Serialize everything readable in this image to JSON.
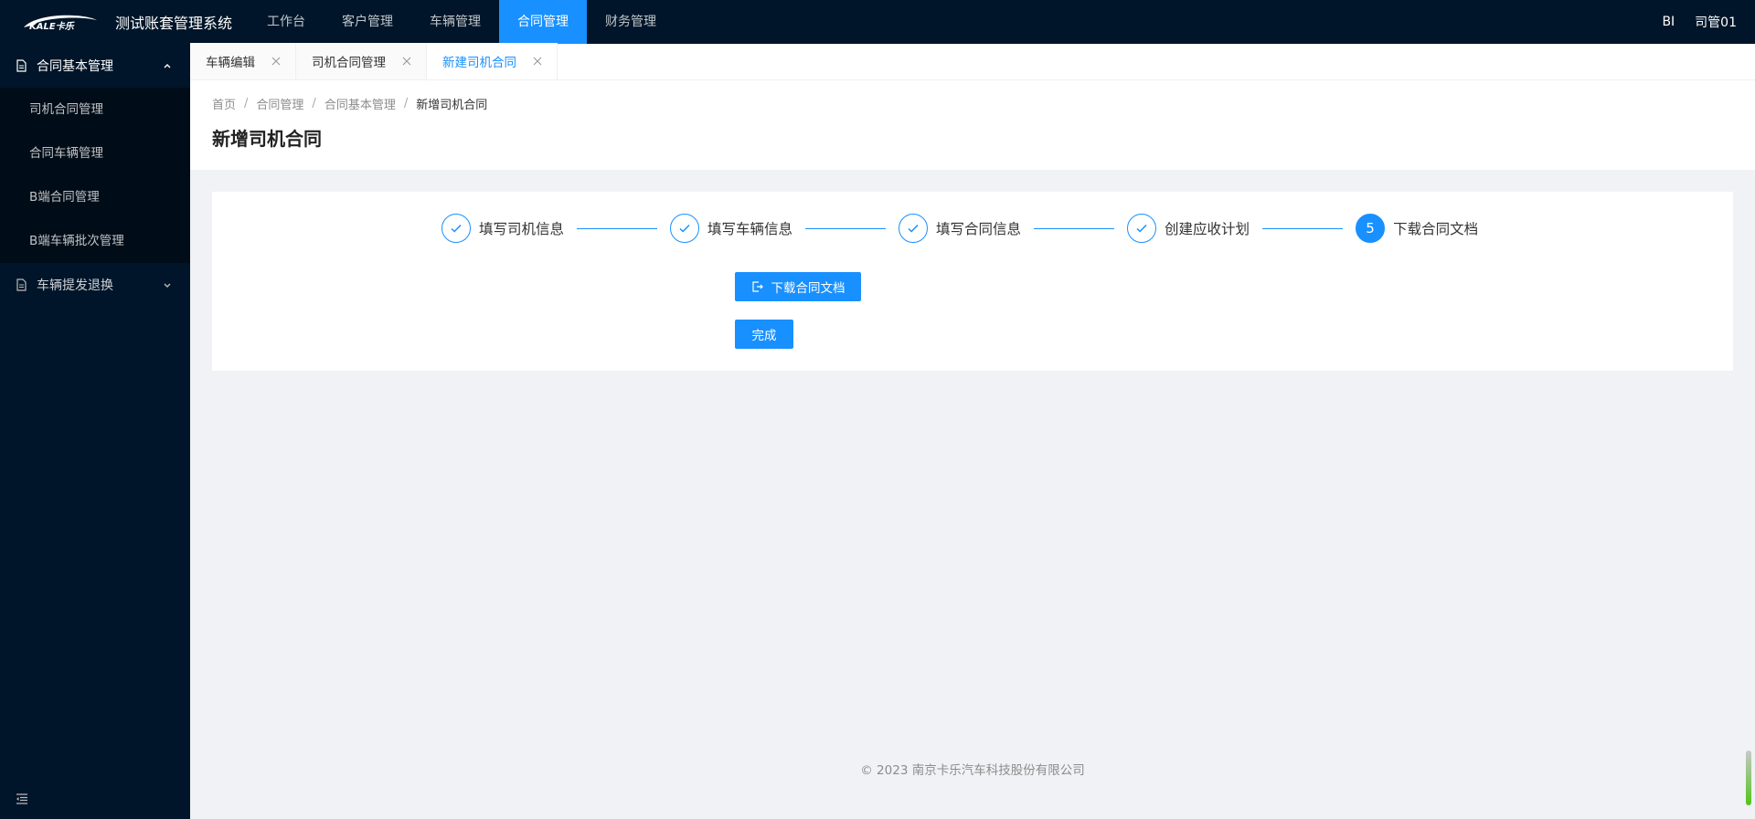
{
  "header": {
    "logo_text": "KALE卡乐",
    "title": "测试账套管理系统",
    "nav": [
      {
        "label": "工作台"
      },
      {
        "label": "客户管理"
      },
      {
        "label": "车辆管理"
      },
      {
        "label": "合同管理"
      },
      {
        "label": "财务管理"
      }
    ],
    "active_nav": "合同管理",
    "bi_label": "BI",
    "user_name": "司管01"
  },
  "sidebar": {
    "groups": [
      {
        "label": "合同基本管理",
        "expanded": true,
        "items": [
          {
            "label": "司机合同管理"
          },
          {
            "label": "合同车辆管理"
          },
          {
            "label": "B端合同管理"
          },
          {
            "label": "B端车辆批次管理"
          }
        ]
      },
      {
        "label": "车辆提发退换",
        "expanded": false
      }
    ]
  },
  "tabs": [
    {
      "label": "车辆编辑"
    },
    {
      "label": "司机合同管理"
    },
    {
      "label": "新建司机合同"
    }
  ],
  "active_tab": "新建司机合同",
  "breadcrumb": [
    "首页",
    "合同管理",
    "合同基本管理",
    "新增司机合同"
  ],
  "page_title": "新增司机合同",
  "steps": [
    {
      "title": "填写司机信息",
      "status": "finished"
    },
    {
      "title": "填写车辆信息",
      "status": "finished"
    },
    {
      "title": "填写合同信息",
      "status": "finished"
    },
    {
      "title": "创建应收计划",
      "status": "finished"
    },
    {
      "title": "下载合同文档",
      "status": "current",
      "number": "5"
    }
  ],
  "buttons": {
    "download": "下载合同文档",
    "finish": "完成"
  },
  "footer": "© 2023 南京卡乐汽车科技股份有限公司",
  "colors": {
    "primary": "#1890ff",
    "nav_bg": "#001529",
    "submenu_bg": "#000c17"
  }
}
